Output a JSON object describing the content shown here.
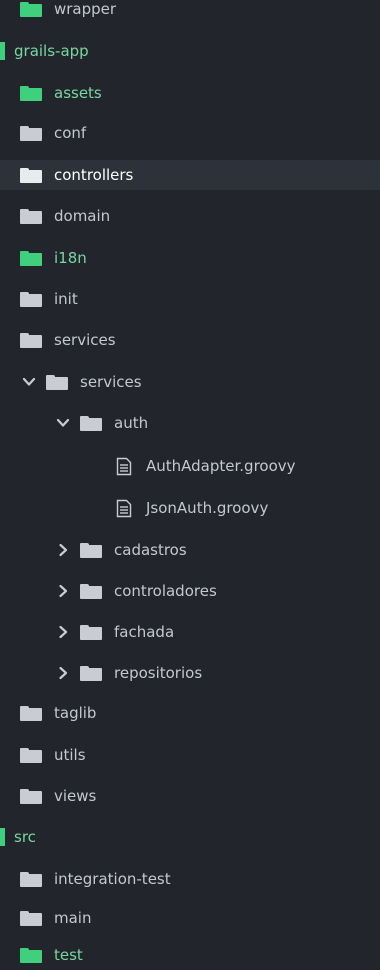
{
  "tree": {
    "wrapper": "wrapper",
    "grails_app": "grails-app",
    "assets": "assets",
    "conf": "conf",
    "controllers": "controllers",
    "domain": "domain",
    "i18n": "i18n",
    "init": "init",
    "services_top": "services",
    "services_inner": "services",
    "auth": "auth",
    "auth_adapter": "AuthAdapter.groovy",
    "json_auth": "JsonAuth.groovy",
    "cadastros": "cadastros",
    "controladores": "controladores",
    "fachada": "fachada",
    "repositorios": "repositorios",
    "taglib": "taglib",
    "utils": "utils",
    "views": "views",
    "src": "src",
    "integration_test": "integration-test",
    "main": "main",
    "test": "test"
  },
  "colors": {
    "background": "#22252b",
    "selected_row": "#2d3139",
    "accent_green": "#3fd07e",
    "folder_gray": "#c9ccd2",
    "text": "#c4c8cf"
  }
}
